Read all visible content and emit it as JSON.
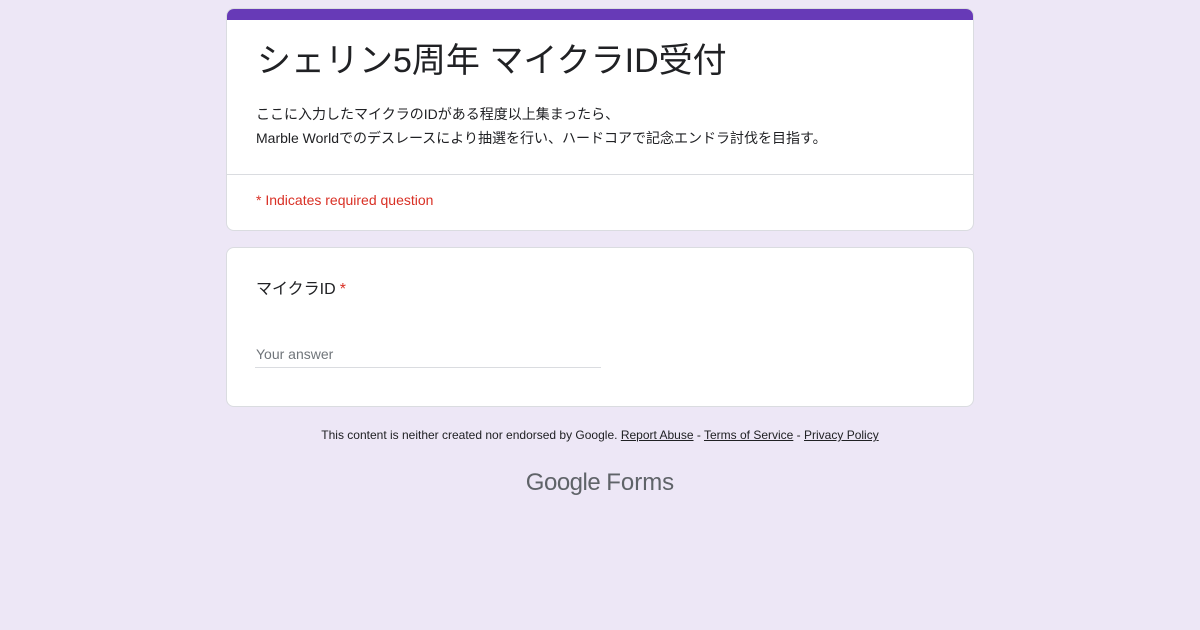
{
  "form": {
    "title": "シェリン5周年 マイクラID受付",
    "description_line1": "ここに入力したマイクラのIDがある程度以上集まったら、",
    "description_line2": "Marble Worldでのデスレースにより抽選を行い、ハードコアで記念エンドラ討伐を目指す。",
    "required_note": "* Indicates required question"
  },
  "question": {
    "label": "マイクラID",
    "required_mark": "*",
    "placeholder": "Your answer",
    "value": ""
  },
  "footer": {
    "disclaimer": "This content is neither created nor endorsed by Google.",
    "report_abuse": "Report Abuse",
    "terms": "Terms of Service",
    "privacy": "Privacy Policy",
    "separator": " - "
  },
  "branding": {
    "google": "Google",
    "forms": "Forms"
  },
  "colors": {
    "accent": "#673ab7",
    "background": "#ede7f6",
    "required": "#d93025"
  }
}
